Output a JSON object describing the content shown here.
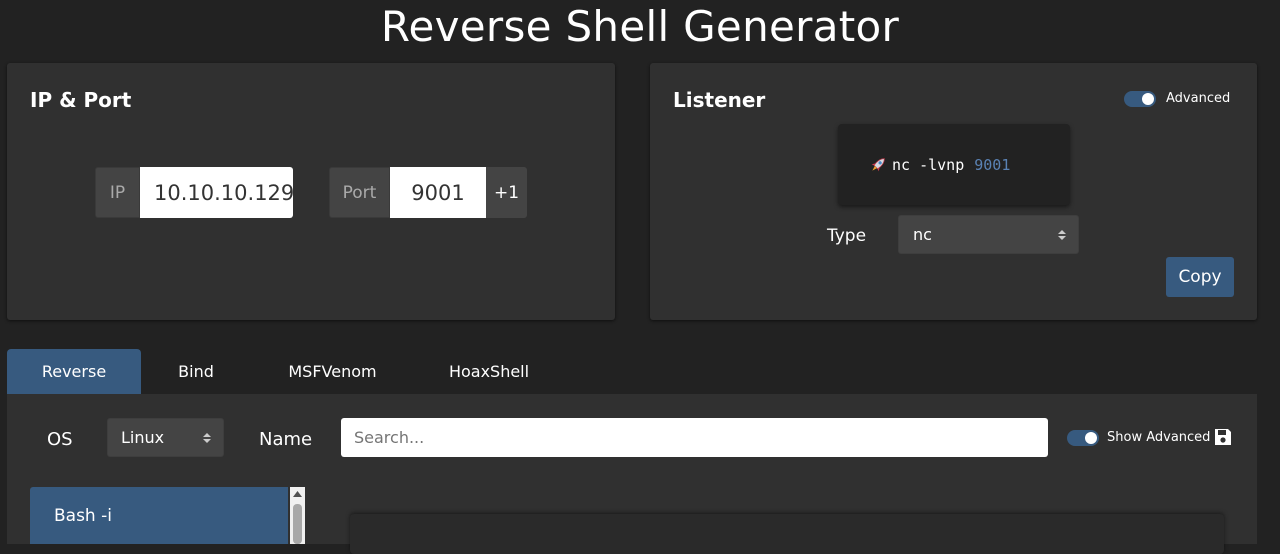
{
  "app": {
    "title": "Reverse Shell Generator"
  },
  "ip_port": {
    "title": "IP & Port",
    "ip_label": "IP",
    "ip_value": "10.10.10.129",
    "port_label": "Port",
    "port_value": "9001",
    "increment_label": "+1"
  },
  "listener": {
    "title": "Listener",
    "advanced_label": "Advanced",
    "advanced_on": true,
    "command_icon": "rocket-icon",
    "command": "nc -lvnp",
    "command_port": "9001",
    "type_label": "Type",
    "type_value": "nc",
    "copy_label": "Copy"
  },
  "tabs": [
    {
      "label": "Reverse",
      "active": true
    },
    {
      "label": "Bind",
      "active": false
    },
    {
      "label": "MSFVenom",
      "active": false
    },
    {
      "label": "HoaxShell",
      "active": false
    }
  ],
  "filters": {
    "os_label": "OS",
    "os_value": "Linux",
    "name_label": "Name",
    "search_placeholder": "Search...",
    "show_advanced_label": "Show Advanced",
    "show_advanced_on": true,
    "save_icon": "save-icon"
  },
  "shell_list": {
    "items": [
      {
        "label": "Bash -i",
        "selected": true
      }
    ]
  },
  "colors": {
    "background": "#222222",
    "card": "#303030",
    "accent": "#375a7f",
    "port_highlight": "#5a82b4"
  }
}
